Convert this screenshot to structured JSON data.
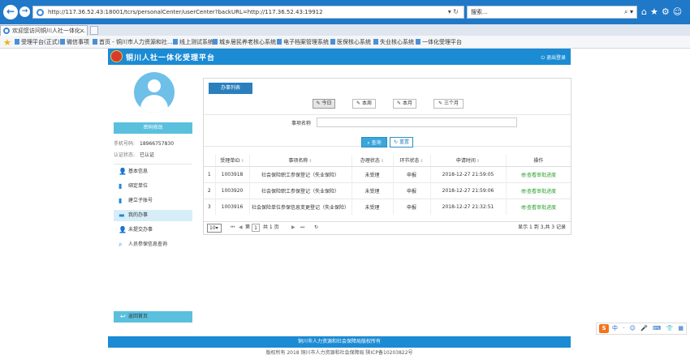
{
  "browser": {
    "address": "http://117.36.52.43:18001/tcrs/personalCenter/userCenter?backURL=http://117.36.52.43:19912",
    "search_placeholder": "搜索...",
    "tab_title": "欢迎您访问铜川人社一体化...",
    "favorites": [
      "受理平台(正式)",
      "微信事项",
      "首页 - 铜川市人力资源和社...",
      "线上测试系统",
      "城乡居民养老核心系统",
      "电子档案管理系统",
      "医保核心系统",
      "失业核心系统",
      "一体化受理平台"
    ]
  },
  "header": {
    "title": "铜川人社一体化受理平台",
    "logout": "退出登录"
  },
  "sidebar": {
    "change_password": "密码修改",
    "phone_label": "手机号码:",
    "phone_value": "18966757830",
    "auth_label": "认证状态:",
    "auth_value": "已认证",
    "menu": [
      {
        "label": "基本信息",
        "icon": "user-icon"
      },
      {
        "label": "绑定单位",
        "icon": "building-icon"
      },
      {
        "label": "建立子账号",
        "icon": "document-icon"
      },
      {
        "label": "我的办事",
        "icon": "folder-icon"
      },
      {
        "label": "未提交办事",
        "icon": "person-icon"
      },
      {
        "label": "人员参保信息查询",
        "icon": "search-icon"
      }
    ],
    "home": "返回首页"
  },
  "main": {
    "tab": "办事列表",
    "date_filters": [
      "今日",
      "本周",
      "本月",
      "三个月"
    ],
    "field_label": "事项名称",
    "query_btn": "查询",
    "reset_btn": "重置",
    "table": {
      "headers": [
        "受理单ID",
        "事项名称",
        "办理状态",
        "环节状态",
        "申请时间",
        "操作"
      ],
      "rows": [
        {
          "idx": "1",
          "id": "1003918",
          "name": "社会保险职工参保登记（失业保险）",
          "status": "未受理",
          "step": "申报",
          "time": "2018-12-27 21:59:05",
          "op": "查看审批进度"
        },
        {
          "idx": "2",
          "id": "1003920",
          "name": "社会保险职工参保登记（失业保险）",
          "status": "未受理",
          "step": "申报",
          "time": "2018-12-27 21:59:06",
          "op": "查看审批进度"
        },
        {
          "idx": "3",
          "id": "1003916",
          "name": "社会保险单位参保信息变更登记（失业保险）",
          "status": "未受理",
          "step": "申报",
          "time": "2018-12-27 21:32:51",
          "op": "查看审批进度"
        }
      ]
    },
    "pager": {
      "page_size": "10",
      "page_label_pre": "第",
      "page": "1",
      "page_label_post": "共 1 页",
      "info": "显示 1 到 3,共 3 记录"
    }
  },
  "footer": {
    "line1": "铜川市人力资源和社会保障局版权所有",
    "line2": "版权所有 2018 铜川市人力资源和社会保障局 陕ICP备10203822号"
  },
  "ime": {
    "logo": "S",
    "text": "中 · ☺ 🎤 ⌨ 👕 ▦"
  }
}
